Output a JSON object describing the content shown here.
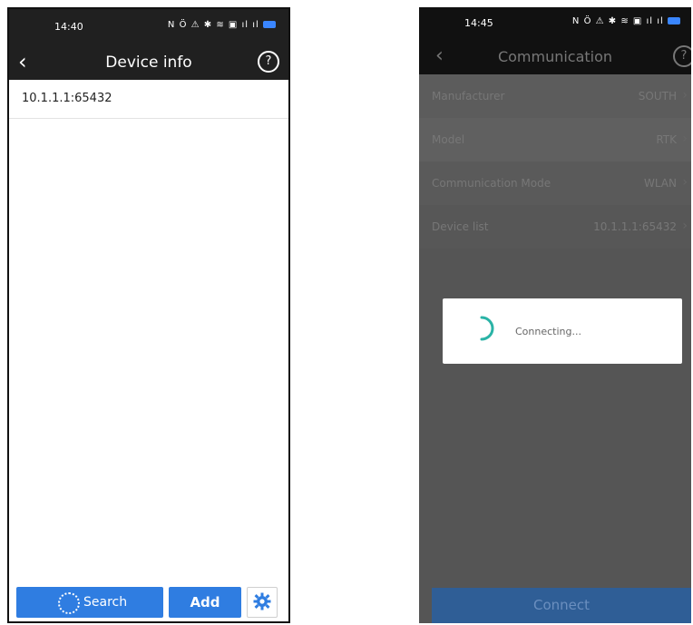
{
  "screen1": {
    "status": {
      "time": "14:40",
      "icons": "N Ö ⚠ ✱ ≋ ▣ ıl ıl"
    },
    "header": {
      "back": "‹",
      "title": "Device info",
      "help": "?"
    },
    "device_item": "10.1.1.1:65432",
    "buttons": {
      "search": "Search",
      "add": "Add",
      "settings_icon": "gear-icon"
    },
    "colors": {
      "accent": "#2f7de1",
      "header": "#202020"
    }
  },
  "screen2": {
    "status": {
      "time": "14:45",
      "icons": "N Ö ⚠ ✱ ≋ ▣ ıl ıl"
    },
    "header": {
      "back": "‹",
      "title": "Communication",
      "help": "?"
    },
    "rows": [
      {
        "label": "Manufacturer",
        "value": "SOUTH",
        "chevron": "›"
      },
      {
        "label": "Model",
        "value": "RTK",
        "chevron": "›"
      },
      {
        "label": "Communication Mode",
        "value": "WLAN",
        "chevron": "›"
      },
      {
        "label": "Device list",
        "value": "10.1.1.1:65432",
        "chevron": "›"
      }
    ],
    "dialog": {
      "message": "Connecting..."
    },
    "connect_label": "Connect",
    "colors": {
      "accent": "#2f5e96",
      "loader": "#2ab3a6"
    }
  }
}
